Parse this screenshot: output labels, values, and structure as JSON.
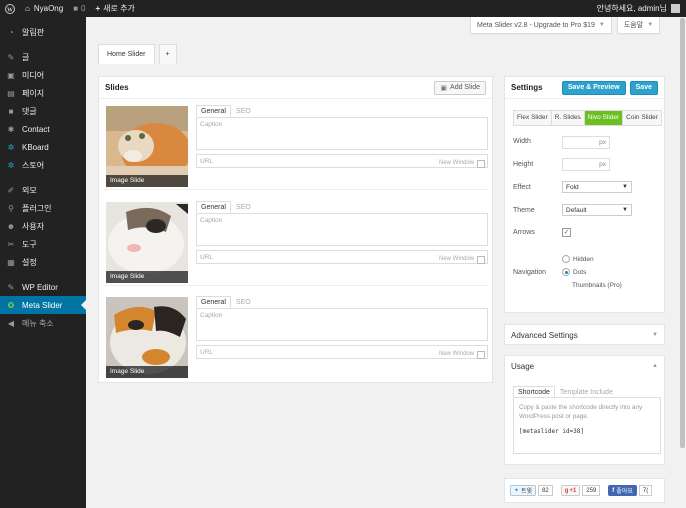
{
  "adminbar": {
    "wp_icon": "wordpress-icon",
    "site_name": "NyaOng",
    "comments_count": "0",
    "new_label": "새로 추가",
    "greeting": "안녕하세요, admin님"
  },
  "sidebar": {
    "items": [
      {
        "label": "알림판",
        "icon": "dashboard-icon"
      },
      {
        "label": "글",
        "icon": "pin-icon"
      },
      {
        "label": "미디어",
        "icon": "media-icon"
      },
      {
        "label": "페이지",
        "icon": "page-icon"
      },
      {
        "label": "댓글",
        "icon": "comment-icon"
      },
      {
        "label": "Contact",
        "icon": "gear-icon"
      },
      {
        "label": "KBoard",
        "icon": "kboard-icon"
      },
      {
        "label": "스토어",
        "icon": "store-icon"
      },
      {
        "label": "외모",
        "icon": "brush-icon"
      },
      {
        "label": "플러그인",
        "icon": "plugin-icon"
      },
      {
        "label": "사용자",
        "icon": "user-icon"
      },
      {
        "label": "도구",
        "icon": "wrench-icon"
      },
      {
        "label": "설정",
        "icon": "settings-icon"
      },
      {
        "label": "WP Editor",
        "icon": "pencil-icon"
      },
      {
        "label": "Meta Slider",
        "icon": "metaslider-icon"
      },
      {
        "label": "메뉴 축소",
        "icon": "collapse-icon"
      }
    ]
  },
  "top_buttons": {
    "upgrade_label": "Meta Slider v2.8 - Upgrade to Pro $19",
    "help_label": "도움말"
  },
  "tabs": {
    "active_label": "Home Slider",
    "add_label": "+"
  },
  "slides_panel": {
    "title": "Slides",
    "add_slide_label": "Add Slide",
    "tab_general": "General",
    "tab_seo": "SEO",
    "caption_placeholder": "Caption",
    "url_placeholder": "URL",
    "new_window_label": "New Window",
    "slides": [
      {
        "type_label": "Image Slide"
      },
      {
        "type_label": "Image Slide"
      },
      {
        "type_label": "Image Slide"
      }
    ]
  },
  "settings": {
    "title": "Settings",
    "save_preview_label": "Save & Preview",
    "save_label": "Save",
    "slider_types": [
      "Flex Slider",
      "R. Slides",
      "Nivo Slider",
      "Coin Slider"
    ],
    "active_slider_type": "Nivo Slider",
    "width_label": "Width",
    "height_label": "Height",
    "unit": "px",
    "effect_label": "Effect",
    "effect_value": "Fold",
    "theme_label": "Theme",
    "theme_value": "Default",
    "arrows_label": "Arrows",
    "arrows_checked": true,
    "navigation_label": "Navigation",
    "navigation_options": [
      "Hidden",
      "Dots",
      "Thumbnails (Pro)"
    ],
    "navigation_selected": "Dots"
  },
  "advanced": {
    "title": "Advanced Settings"
  },
  "usage": {
    "title": "Usage",
    "tab_shortcode": "Shortcode",
    "tab_template": "Template Include",
    "description": "Copy & paste the shortcode directly into any WordPress post or page.",
    "shortcode": "[metaslider id=38]"
  },
  "social": {
    "tweet_label": "트윗",
    "tweet_count": "82",
    "gplus_label": "+1",
    "gplus_count": "259",
    "fb_label": "좋아요",
    "fb_count": "7(",
    "accent": "#0074a2"
  }
}
